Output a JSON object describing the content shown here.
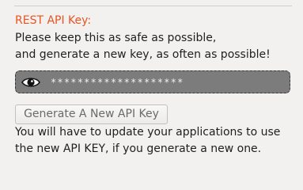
{
  "section": {
    "title": "REST API Key:",
    "description_lines": [
      "Please keep this as safe as possible,",
      "and generate a new key, as often as possible!"
    ]
  },
  "api_key": {
    "masked_value": "********************",
    "toggle_icon": "eye-icon"
  },
  "generate_button": {
    "label": "Generate A New API Key"
  },
  "note_lines": [
    "You will have to update your applications to use",
    "the new API KEY, if you generate a new one."
  ],
  "colors": {
    "title": "#e95420",
    "field_background": "#7c7c7c",
    "page_background": "#f2f1f0"
  }
}
